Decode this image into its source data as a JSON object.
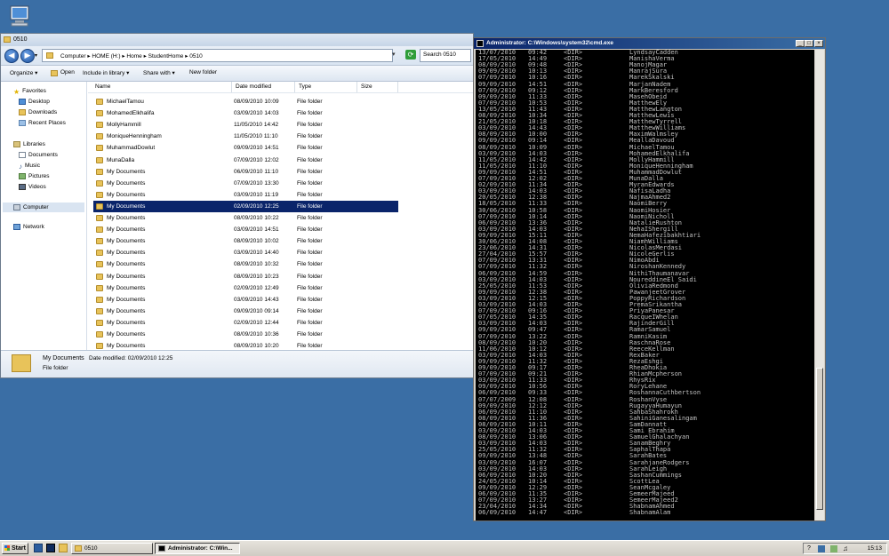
{
  "explorer": {
    "title": "0510",
    "breadcrumb": "Computer  ▸  HOME (H:)  ▸  Home  ▸  StudentHome  ▸  0510",
    "search_placeholder": "Search 0510",
    "toolbar": {
      "organize": "Organize ▾",
      "open": "Open",
      "include": "Include in library ▾",
      "share": "Share with ▾",
      "new_folder": "New folder"
    },
    "nav": {
      "favorites": "Favorites",
      "desktop": "Desktop",
      "downloads": "Downloads",
      "recent": "Recent Places",
      "libraries": "Libraries",
      "documents": "Documents",
      "music": "Music",
      "pictures": "Pictures",
      "videos": "Videos",
      "computer": "Computer",
      "network": "Network"
    },
    "columns": {
      "name": "Name",
      "date": "Date modified",
      "type": "Type",
      "size": "Size"
    },
    "files": [
      {
        "name": "MichaelTamou",
        "date": "08/09/2010 10:09",
        "type": "File folder"
      },
      {
        "name": "MohamedElkhalifa",
        "date": "03/09/2010 14:03",
        "type": "File folder"
      },
      {
        "name": "MollyHammill",
        "date": "11/05/2010 14:42",
        "type": "File folder"
      },
      {
        "name": "MoniqueHenningham",
        "date": "11/05/2010 11:10",
        "type": "File folder"
      },
      {
        "name": "MuhammadDowlut",
        "date": "09/09/2010 14:51",
        "type": "File folder"
      },
      {
        "name": "MunaDalla",
        "date": "07/09/2010 12:02",
        "type": "File folder"
      },
      {
        "name": "My Documents",
        "date": "06/09/2010 11:10",
        "type": "File folder"
      },
      {
        "name": "My Documents",
        "date": "07/09/2010 13:30",
        "type": "File folder"
      },
      {
        "name": "My Documents",
        "date": "03/09/2010 11:19",
        "type": "File folder"
      },
      {
        "name": "My Documents",
        "date": "02/09/2010 12:25",
        "type": "File folder",
        "selected": true
      },
      {
        "name": "My Documents",
        "date": "08/09/2010 10:22",
        "type": "File folder"
      },
      {
        "name": "My Documents",
        "date": "03/09/2010 14:51",
        "type": "File folder"
      },
      {
        "name": "My Documents",
        "date": "08/09/2010 10:02",
        "type": "File folder"
      },
      {
        "name": "My Documents",
        "date": "03/09/2010 14:40",
        "type": "File folder"
      },
      {
        "name": "My Documents",
        "date": "08/09/2010 10:32",
        "type": "File folder"
      },
      {
        "name": "My Documents",
        "date": "08/09/2010 10:23",
        "type": "File folder"
      },
      {
        "name": "My Documents",
        "date": "02/09/2010 12:49",
        "type": "File folder"
      },
      {
        "name": "My Documents",
        "date": "03/09/2010 14:43",
        "type": "File folder"
      },
      {
        "name": "My Documents",
        "date": "09/09/2010 09:14",
        "type": "File folder"
      },
      {
        "name": "My Documents",
        "date": "02/09/2010 12:44",
        "type": "File folder"
      },
      {
        "name": "My Documents",
        "date": "08/09/2010 10:36",
        "type": "File folder"
      },
      {
        "name": "My Documents",
        "date": "08/09/2010 10:20",
        "type": "File folder"
      }
    ],
    "details": {
      "name": "My Documents",
      "date": "Date modified: 02/09/2010 12:25",
      "type": "File folder"
    }
  },
  "cmd": {
    "title": "Administrator: C:\\Windows\\system32\\cmd.exe",
    "dir_tag": "<DIR>",
    "lines": [
      [
        "13/07/2010",
        "09:42",
        "LyndsayCadden"
      ],
      [
        "17/05/2010",
        "14:49",
        "ManishaVerma"
      ],
      [
        "08/09/2010",
        "09:48",
        "ManojMagar"
      ],
      [
        "09/09/2010",
        "10:13",
        "ManrajSura"
      ],
      [
        "07/09/2010",
        "10:16",
        "MarekSkalski"
      ],
      [
        "09/09/2010",
        "14:51",
        "MarjanNadem"
      ],
      [
        "07/09/2010",
        "09:12",
        "MarkBeresford"
      ],
      [
        "09/09/2010",
        "11:33",
        "MasehObeid"
      ],
      [
        "07/09/2010",
        "10:53",
        "MatthewEly"
      ],
      [
        "13/05/2010",
        "11:43",
        "MatthewLangton"
      ],
      [
        "08/09/2010",
        "10:34",
        "MatthewLewis"
      ],
      [
        "21/05/2010",
        "10:18",
        "MatthewTyrrell"
      ],
      [
        "03/09/2010",
        "14:43",
        "MatthewWilliams"
      ],
      [
        "08/09/2010",
        "10:00",
        "MaximWalmsley"
      ],
      [
        "09/09/2010",
        "09:14",
        "MeallaDavoud"
      ],
      [
        "08/09/2010",
        "10:09",
        "MichaelTamou"
      ],
      [
        "03/09/2010",
        "14:03",
        "MohamedElkhalifa"
      ],
      [
        "11/05/2010",
        "14:42",
        "MollyHammill"
      ],
      [
        "11/05/2010",
        "11:10",
        "MoniqueHenningham"
      ],
      [
        "09/09/2010",
        "14:51",
        "MuhammadDowlut"
      ],
      [
        "07/09/2010",
        "12:02",
        "MunaDalla"
      ],
      [
        "02/09/2010",
        "11:34",
        "MyranEdwards"
      ],
      [
        "03/09/2010",
        "14:03",
        "NafisaLadha"
      ],
      [
        "20/05/2010",
        "12:38",
        "NajmaAhmed2"
      ],
      [
        "18/05/2010",
        "11:33",
        "NaomiBerry"
      ],
      [
        "30/06/2010",
        "10:58",
        "NaomiHosier"
      ],
      [
        "07/09/2010",
        "10:14",
        "NaomiNicholl"
      ],
      [
        "06/09/2010",
        "13:36",
        "NatalieRushton"
      ],
      [
        "03/09/2010",
        "14:03",
        "NehaIShergill"
      ],
      [
        "09/09/2010",
        "15:11",
        "NemaHafezibakhtiari"
      ],
      [
        "30/06/2010",
        "14:08",
        "NiamhWilliams"
      ],
      [
        "23/06/2010",
        "14:31",
        "NicolasMerdasi"
      ],
      [
        "27/04/2010",
        "15:57",
        "NicoleGerlis"
      ],
      [
        "07/09/2010",
        "13:31",
        "NimoAbdi"
      ],
      [
        "07/09/2010",
        "11:32",
        "NiroshanKennedy"
      ],
      [
        "06/09/2010",
        "14:59",
        "NithiThaumanavar"
      ],
      [
        "03/09/2010",
        "14:03",
        "NoureddineEl Saidi"
      ],
      [
        "25/05/2010",
        "11:53",
        "OliviaRedmond"
      ],
      [
        "09/09/2010",
        "12:38",
        "PawanjeetGrover"
      ],
      [
        "03/09/2010",
        "12:15",
        "PoppyRichardson"
      ],
      [
        "03/09/2010",
        "14:03",
        "PremaSrikantha"
      ],
      [
        "07/09/2010",
        "09:16",
        "PriyaPanesar"
      ],
      [
        "07/05/2010",
        "14:35",
        "RacqueIWhelan"
      ],
      [
        "03/09/2010",
        "14:03",
        "RajinderGill"
      ],
      [
        "09/09/2010",
        "09:47",
        "RamarSamuel"
      ],
      [
        "07/09/2010",
        "13:22",
        "RamniKasim"
      ],
      [
        "08/09/2010",
        "10:20",
        "RaschnaRose"
      ],
      [
        "11/06/2010",
        "10:12",
        "ReeceKellman"
      ],
      [
        "03/09/2010",
        "14:03",
        "RexBaker"
      ],
      [
        "09/09/2010",
        "11:32",
        "RezaEshgi"
      ],
      [
        "09/09/2010",
        "09:17",
        "RheaDhokia"
      ],
      [
        "07/09/2010",
        "09:21",
        "RhianMcpherson"
      ],
      [
        "03/09/2010",
        "11:33",
        "RhysRix"
      ],
      [
        "09/09/2010",
        "10:56",
        "RoryLehane"
      ],
      [
        "06/09/2010",
        "09:33",
        "RoshannaCuthbertson"
      ],
      [
        "07/07/2009",
        "12:08",
        "RoshanVyse"
      ],
      [
        "09/09/2010",
        "12:12",
        "RugayyaHumayun"
      ],
      [
        "06/09/2010",
        "11:10",
        "SahbaShahrokh"
      ],
      [
        "08/09/2010",
        "11:36",
        "SahiniGanesalingam"
      ],
      [
        "08/09/2010",
        "10:11",
        "SamDannatt"
      ],
      [
        "03/09/2010",
        "14:03",
        "Sami Ebrahim"
      ],
      [
        "08/09/2010",
        "13:06",
        "SamuelGhalachyan"
      ],
      [
        "03/09/2010",
        "14:03",
        "SanamBeghry"
      ],
      [
        "25/05/2010",
        "11:32",
        "SaphalThapa"
      ],
      [
        "09/09/2010",
        "13:48",
        "SarahBates"
      ],
      [
        "03/09/2010",
        "16:07",
        "SarahjaneRodgers"
      ],
      [
        "03/09/2010",
        "14:03",
        "SarahLeigh"
      ],
      [
        "06/09/2010",
        "10:20",
        "SashanCummings"
      ],
      [
        "24/05/2010",
        "10:14",
        "ScottLea"
      ],
      [
        "09/09/2010",
        "12:29",
        "SeanMcgaley"
      ],
      [
        "06/09/2010",
        "11:35",
        "SemeerMajeed"
      ],
      [
        "07/09/2010",
        "13:27",
        "SemeerMajeed2"
      ],
      [
        "23/04/2010",
        "14:34",
        "ShabnamAhmed"
      ],
      [
        "06/09/2010",
        "14:47",
        "ShabnamAlam"
      ]
    ]
  },
  "taskbar": {
    "start": "Start",
    "task_explorer": "0510",
    "task_cmd": "Administrator: C:\\Win...",
    "clock": "15:13"
  }
}
